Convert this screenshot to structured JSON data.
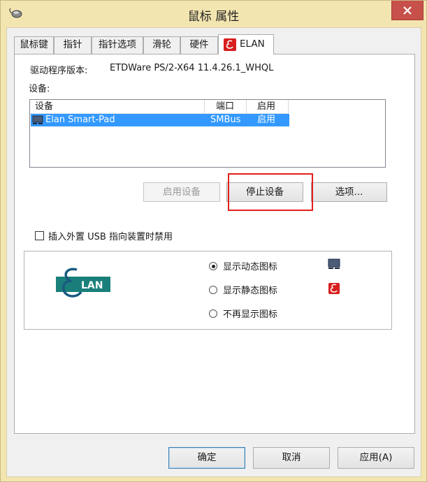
{
  "window": {
    "title": "鼠标 属性"
  },
  "tabs": [
    {
      "label": "鼠标键"
    },
    {
      "label": "指针"
    },
    {
      "label": "指针选项"
    },
    {
      "label": "滑轮"
    },
    {
      "label": "硬件"
    },
    {
      "label": "ELAN"
    }
  ],
  "driver": {
    "label": "驱动程序版本:",
    "value": "ETDWare PS/2-X64 11.4.26.1_WHQL"
  },
  "devices": {
    "label": "设备:",
    "columns": [
      "设备",
      "端口",
      "启用"
    ],
    "rows": [
      {
        "device": "Elan Smart-Pad",
        "port": "SMBus",
        "enabled": "启用"
      }
    ]
  },
  "buttons": {
    "enable_device": "启用设备",
    "stop_device": "停止设备",
    "options": "选项..."
  },
  "usb_disable": {
    "label": "插入外置 USB 指向装置时禁用",
    "checked": false
  },
  "icon_options": {
    "logo_text": "LAN",
    "items": [
      {
        "label": "显示动态图标",
        "checked": true
      },
      {
        "label": "显示静态图标",
        "checked": false
      },
      {
        "label": "不再显示图标",
        "checked": false
      }
    ]
  },
  "footer": {
    "ok": "确定",
    "cancel": "取消",
    "apply": "应用(A)"
  },
  "colors": {
    "titlebar": "#f3e5b0",
    "selection": "#3399ff",
    "highlight_box": "#e0201c",
    "close_button": "#c7504b",
    "elan_red": "#d81e1e",
    "elan_logo_teal": "#1a7f7a"
  }
}
